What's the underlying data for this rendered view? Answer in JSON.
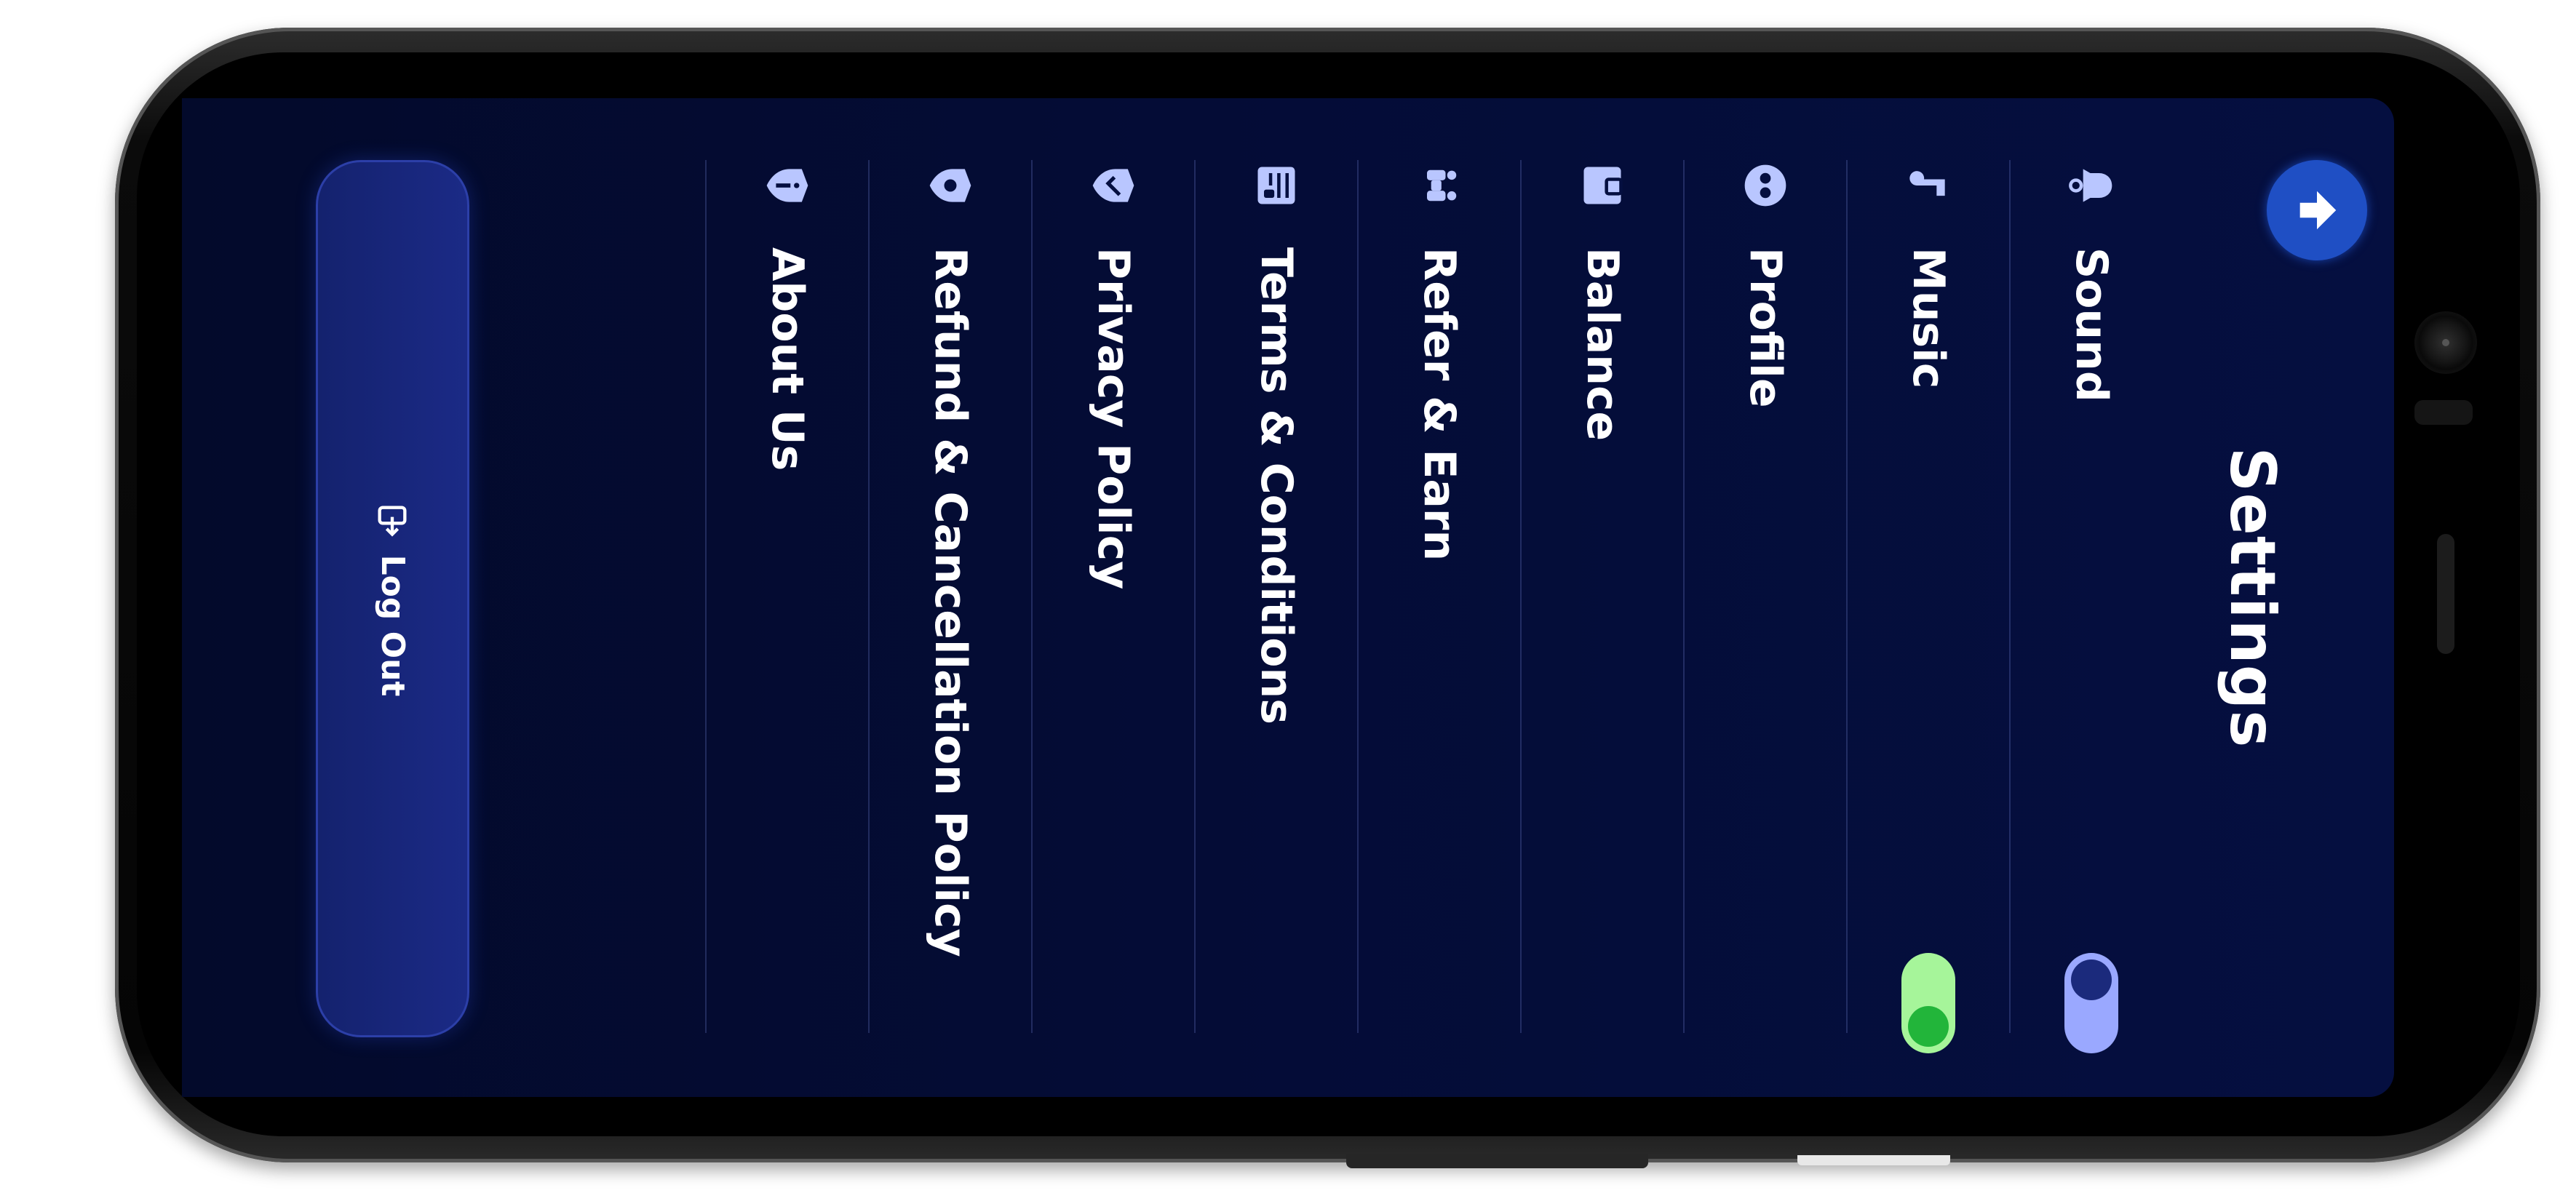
{
  "app": {
    "title": "Settings",
    "back_icon": "arrow-up-icon",
    "accent_color": "#1f4fc4"
  },
  "menu": {
    "items": [
      {
        "label": "Sound",
        "icon": "bell-icon",
        "toggle": "off"
      },
      {
        "label": "Music",
        "icon": "music-note-icon",
        "toggle": "on"
      },
      {
        "label": "Profile",
        "icon": "profile-icon"
      },
      {
        "label": "Balance",
        "icon": "wallet-icon"
      },
      {
        "label": "Refer & Earn",
        "icon": "refer-icon"
      },
      {
        "label": "Terms & Conditions",
        "icon": "document-icon"
      },
      {
        "label": "Privacy Policy",
        "icon": "shield-check-icon"
      },
      {
        "label": "Refund & Cancellation Policy",
        "icon": "shield-refund-icon"
      },
      {
        "label": "About Us",
        "icon": "shield-info-icon"
      }
    ]
  },
  "logout": {
    "label": "Log Out",
    "icon": "logout-icon"
  },
  "colors": {
    "background": "#040c36",
    "toggle_on": "#a6f59a",
    "toggle_off": "#9aa8ff"
  }
}
